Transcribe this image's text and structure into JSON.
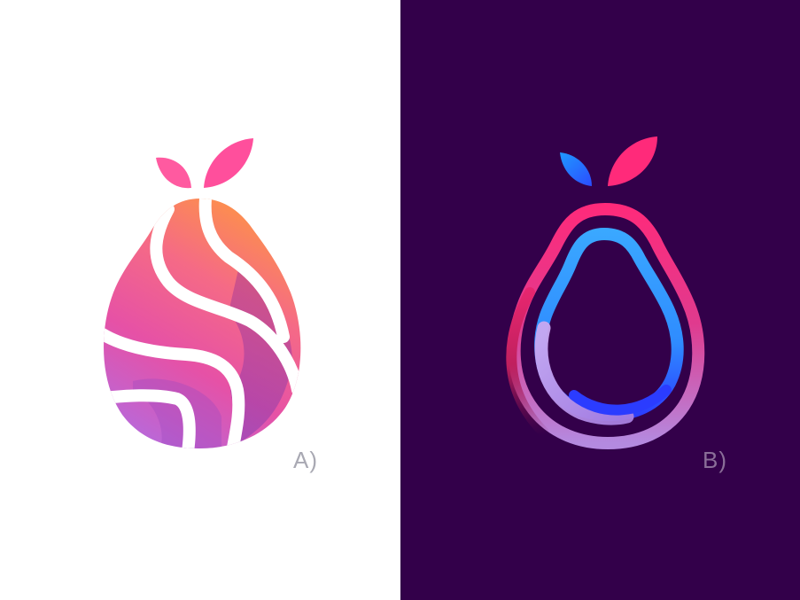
{
  "panels": [
    {
      "label": "A)",
      "background": "#ffffff",
      "logo_icon": "pear-stripes-icon",
      "colors": {
        "leaf": "#ff4f9c",
        "gradient_start": "#ff9a3c",
        "gradient_mid": "#f0509a",
        "gradient_end": "#b36be0",
        "label": "#a9a9b3"
      }
    },
    {
      "label": "B)",
      "background": "#33004a",
      "logo_icon": "pear-outline-icon",
      "colors": {
        "leaf_left": "#1f7bff",
        "leaf_right": "#ff2a7a",
        "outer_ring_top": "#ff2a7a",
        "outer_ring_bottom": "#b48ae0",
        "inner_ring_top": "#3aa8ff",
        "inner_ring_bottom": "#3050ff",
        "label": "#8a6e98"
      }
    }
  ]
}
